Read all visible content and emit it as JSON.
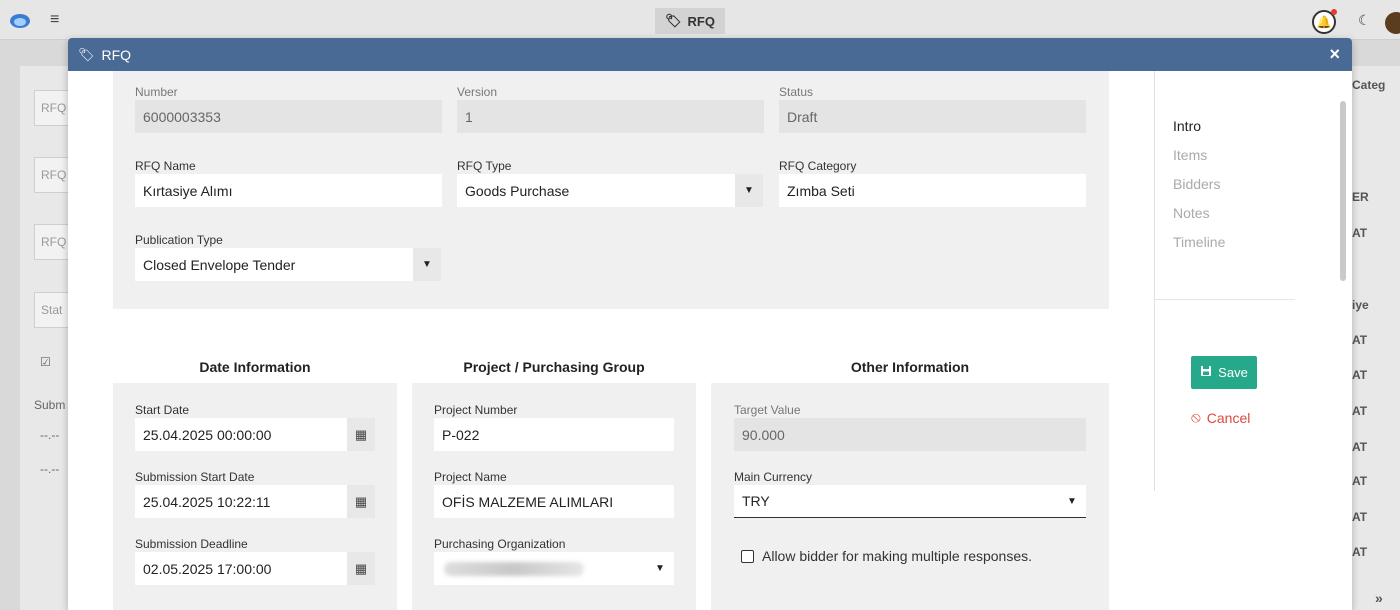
{
  "app": {
    "header_title": "RFQ",
    "bg_left_fields": [
      "RFQ",
      "RFQ",
      "RFQ",
      "Stat"
    ],
    "bg_left_texts": [
      "Subm",
      "--.--",
      "--.--"
    ],
    "bg_right_cells": [
      "Categ",
      "ER",
      "AT",
      "iye",
      "AT",
      "AT",
      "AT",
      "AT",
      "AT",
      "AT",
      "AT"
    ],
    "pager_icon": "»"
  },
  "modal": {
    "title": "RFQ",
    "close": "×"
  },
  "form": {
    "number_label": "Number",
    "number_value": "6000003353",
    "version_label": "Version",
    "version_value": "1",
    "status_label": "Status",
    "status_value": "Draft",
    "rfq_name_label": "RFQ Name",
    "rfq_name_value": "Kırtasiye Alımı",
    "rfq_type_label": "RFQ Type",
    "rfq_type_value": "Goods Purchase",
    "rfq_category_label": "RFQ Category",
    "rfq_category_value": "Zımba Seti",
    "publication_type_label": "Publication Type",
    "publication_type_value": "Closed Envelope Tender"
  },
  "sections": {
    "date_title": "Date Information",
    "project_title": "Project / Purchasing Group",
    "other_title": "Other Information"
  },
  "date_info": {
    "start_date_label": "Start Date",
    "start_date_value": "25.04.2025 00:00:00",
    "submission_start_label": "Submission Start Date",
    "submission_start_value": "25.04.2025 10:22:11",
    "deadline_label": "Submission Deadline",
    "deadline_value": "02.05.2025 17:00:00"
  },
  "project": {
    "project_number_label": "Project Number",
    "project_number_value": "P-022",
    "project_name_label": "Project Name",
    "project_name_value": "OFİS MALZEME ALIMLARI",
    "purchasing_org_label": "Purchasing Organization"
  },
  "other": {
    "target_value_label": "Target Value",
    "target_value": "90.000",
    "main_currency_label": "Main Currency",
    "main_currency_value": "TRY",
    "allow_multiple_label": "Allow bidder for making multiple responses."
  },
  "side_nav": {
    "items": [
      "Intro",
      "Items",
      "Bidders",
      "Notes",
      "Timeline"
    ],
    "save_label": "Save",
    "cancel_label": "Cancel"
  },
  "icons": {
    "dropdown": "▼",
    "calendar": "▦",
    "save": "💾",
    "cancel": "⦸",
    "menu": "≡",
    "bell": "🔔",
    "moon": "☾"
  },
  "colors": {
    "header": "#4a6a96",
    "save": "#26a98b",
    "cancel": "#e0483e",
    "panel": "#f0f0f0"
  }
}
